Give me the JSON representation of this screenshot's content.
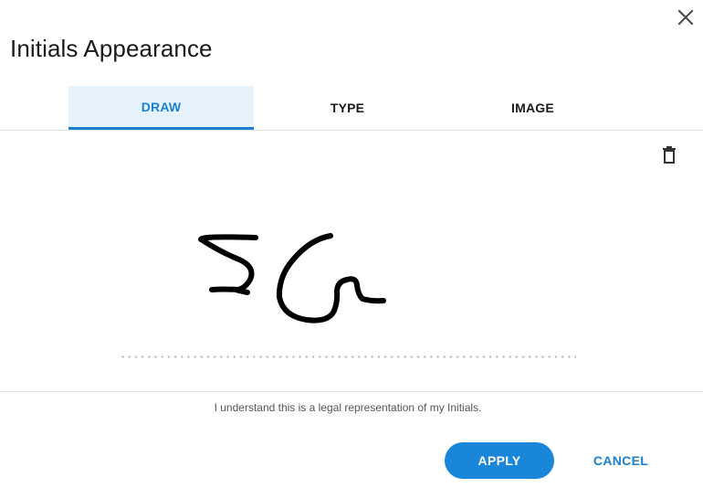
{
  "dialog": {
    "title": "Initials Appearance",
    "close_icon": "close-icon"
  },
  "tabs": [
    {
      "label": "DRAW",
      "active": true
    },
    {
      "label": "TYPE",
      "active": false
    },
    {
      "label": "IMAGE",
      "active": false
    }
  ],
  "draw_area": {
    "clear_icon": "trash-icon",
    "ink_color": "#000000",
    "drawn_initials": "SG"
  },
  "legal_notice": "I understand this is a legal representation of my Initials.",
  "buttons": {
    "apply": "APPLY",
    "cancel": "CANCEL"
  },
  "colors": {
    "accent": "#1a86d9",
    "active_tab_bg": "#e6f2fc"
  }
}
